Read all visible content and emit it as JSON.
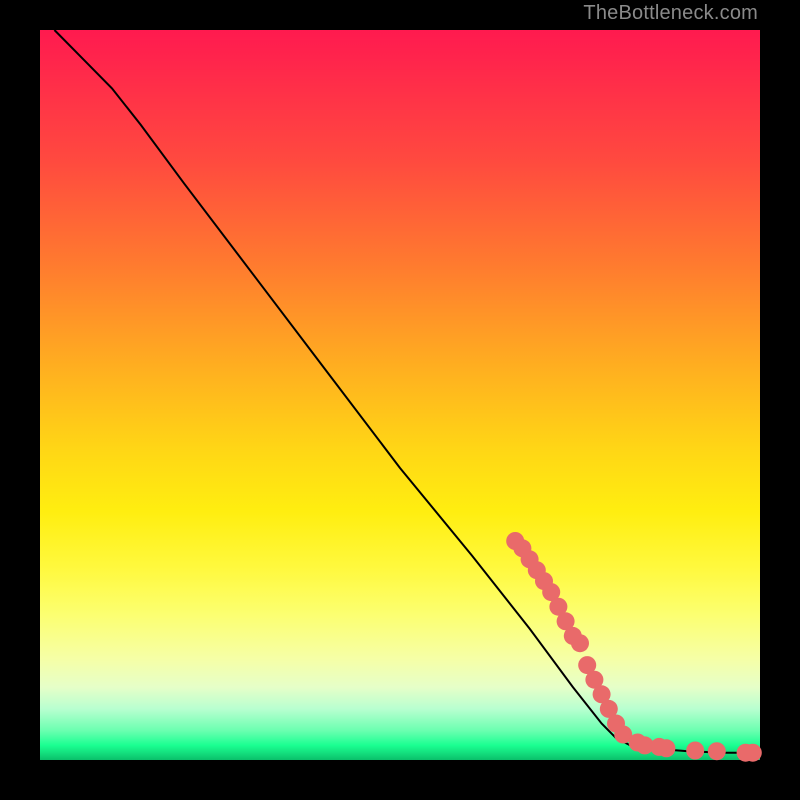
{
  "watermark": "TheBottleneck.com",
  "chart_data": {
    "type": "line",
    "title": "",
    "xlabel": "",
    "ylabel": "",
    "xlim": [
      0,
      100
    ],
    "ylim": [
      0,
      100
    ],
    "grid": false,
    "curve": [
      {
        "x": 2,
        "y": 100
      },
      {
        "x": 6,
        "y": 96
      },
      {
        "x": 10,
        "y": 92
      },
      {
        "x": 14,
        "y": 87
      },
      {
        "x": 20,
        "y": 79
      },
      {
        "x": 30,
        "y": 66
      },
      {
        "x": 40,
        "y": 53
      },
      {
        "x": 50,
        "y": 40
      },
      {
        "x": 60,
        "y": 28
      },
      {
        "x": 68,
        "y": 18
      },
      {
        "x": 74,
        "y": 10
      },
      {
        "x": 78,
        "y": 5
      },
      {
        "x": 80,
        "y": 3
      },
      {
        "x": 82,
        "y": 2
      },
      {
        "x": 86,
        "y": 1.5
      },
      {
        "x": 90,
        "y": 1.2
      },
      {
        "x": 95,
        "y": 1.0
      },
      {
        "x": 100,
        "y": 1.0
      }
    ],
    "markers": [
      {
        "x": 66,
        "y": 30
      },
      {
        "x": 67,
        "y": 29
      },
      {
        "x": 68,
        "y": 27.5
      },
      {
        "x": 69,
        "y": 26
      },
      {
        "x": 70,
        "y": 24.5
      },
      {
        "x": 71,
        "y": 23
      },
      {
        "x": 72,
        "y": 21
      },
      {
        "x": 73,
        "y": 19
      },
      {
        "x": 74,
        "y": 17
      },
      {
        "x": 75,
        "y": 16
      },
      {
        "x": 76,
        "y": 13
      },
      {
        "x": 77,
        "y": 11
      },
      {
        "x": 78,
        "y": 9
      },
      {
        "x": 79,
        "y": 7
      },
      {
        "x": 80,
        "y": 5
      },
      {
        "x": 81,
        "y": 3.5
      },
      {
        "x": 83,
        "y": 2.4
      },
      {
        "x": 84,
        "y": 2.0
      },
      {
        "x": 86,
        "y": 1.8
      },
      {
        "x": 87,
        "y": 1.6
      },
      {
        "x": 91,
        "y": 1.3
      },
      {
        "x": 94,
        "y": 1.2
      },
      {
        "x": 98,
        "y": 1.0
      },
      {
        "x": 99,
        "y": 1.0
      }
    ],
    "marker_color": "#e96a6a",
    "line_color": "#000000"
  }
}
